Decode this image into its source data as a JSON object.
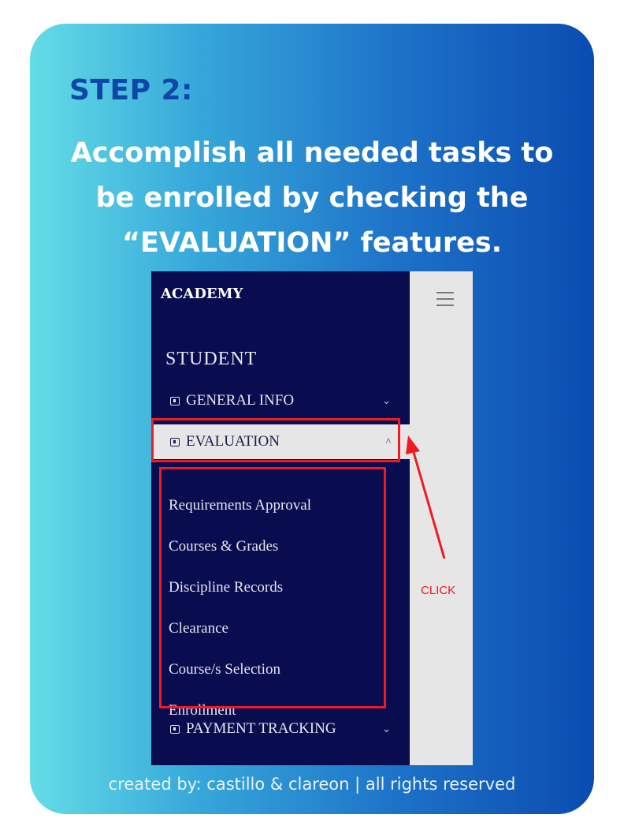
{
  "card": {
    "step_title": "STEP 2:",
    "headline_lines": [
      "Accomplish all needed tasks to",
      "be enrolled by checking the",
      "“EVALUATION” features."
    ],
    "footer": "created by: castillo & clareon | all rights reserved"
  },
  "screenshot": {
    "brand": "ACADEMY",
    "menu_icon": "hamburger-icon",
    "section_label": "STUDENT",
    "menu": [
      {
        "label": "GENERAL INFO",
        "icon": "info-icon",
        "chevron": "⌄",
        "state": "collapsed"
      },
      {
        "label": "EVALUATION",
        "icon": "id-card-icon",
        "chevron": "^",
        "state": "expanded"
      },
      {
        "label": "PAYMENT TRACKING",
        "icon": "receipt-icon",
        "chevron": "⌄",
        "state": "collapsed"
      }
    ],
    "evaluation_items": [
      "Requirements Approval",
      "Courses & Grades",
      "Discipline Records",
      "Clearance",
      "Course/s Selection",
      "Enrollment"
    ]
  },
  "annotation": {
    "click_label": "CLICK",
    "color": "#ee1b24"
  },
  "colors": {
    "sidebar_bg": "#0a0c50",
    "step_title": "#0f47a8",
    "card_gradient_start": "#64dde6",
    "card_gradient_end": "#0a4cb0"
  }
}
